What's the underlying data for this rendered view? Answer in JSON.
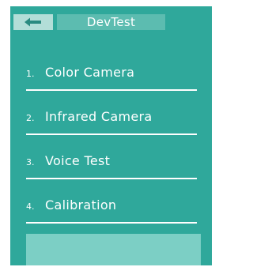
{
  "header": {
    "title": "DevTest",
    "back_icon": "back-arrow-icon"
  },
  "menu": {
    "items": [
      {
        "number": "1.",
        "label": "Color Camera"
      },
      {
        "number": "2.",
        "label": "Infrared Camera"
      },
      {
        "number": "3.",
        "label": "Voice Test"
      },
      {
        "number": "4.",
        "label": "Calibration"
      }
    ]
  },
  "colors": {
    "background": "#2fa89b",
    "title_bg": "#5cbcb0",
    "back_button_bg": "#b3ded8",
    "bottom_panel_bg": "#7ccfc5",
    "text": "#ffffff"
  }
}
